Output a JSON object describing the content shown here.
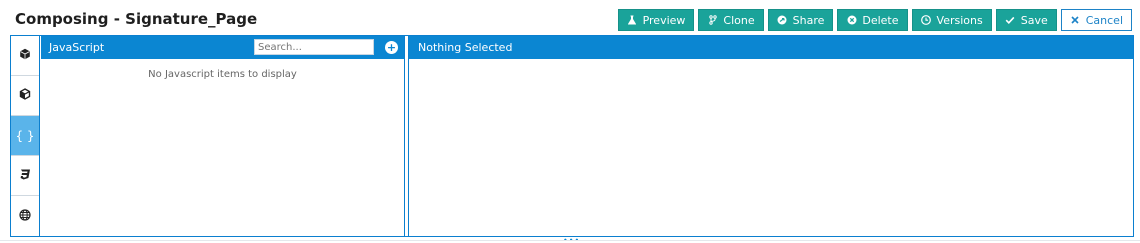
{
  "header": {
    "title": "Composing - Signature_Page"
  },
  "toolbar": {
    "preview_label": "Preview",
    "clone_label": "Clone",
    "share_label": "Share",
    "delete_label": "Delete",
    "versions_label": "Versions",
    "save_label": "Save",
    "cancel_label": "Cancel"
  },
  "rail": {
    "items": [
      {
        "icon": "cube-icon"
      },
      {
        "icon": "box-icon"
      },
      {
        "icon": "braces-icon",
        "text": "{ }",
        "active": true
      },
      {
        "icon": "css3-icon"
      },
      {
        "icon": "globe-icon"
      }
    ]
  },
  "left_panel": {
    "title": "JavaScript",
    "search_placeholder": "Search...",
    "empty_message": "No Javascript items to display"
  },
  "right_panel": {
    "title": "Nothing Selected"
  },
  "colors": {
    "accent": "#0b86d2",
    "teal_button": "#1aa39a",
    "active_rail": "#5ab4ea"
  }
}
